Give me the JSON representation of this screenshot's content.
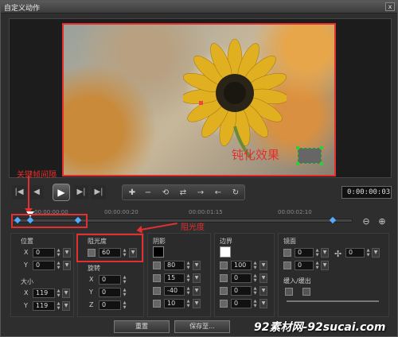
{
  "window": {
    "title": "自定义动作",
    "close_glyph": "x"
  },
  "preview": {
    "annotation_text": "钝化效果"
  },
  "annotations": {
    "keyframe_interval": "关键帧间隔",
    "opacity_pointer": "阻光度"
  },
  "transport": {
    "home_icon": "|◀",
    "prev_icon": "◀",
    "play_icon": "▶",
    "next_icon": "▶|",
    "end_icon": "▶|",
    "timecode": "0:00:00:03",
    "tools": [
      "✚",
      "−",
      "⟲",
      "⇄",
      "→",
      "←",
      "↻"
    ]
  },
  "timeline": {
    "labels": [
      "00:00:00:00",
      "00:00:00:20",
      "00:00:01:15",
      "00:00:02:10"
    ],
    "zoom_out": "⊖",
    "zoom_in": "⊕"
  },
  "position": {
    "label": "位置",
    "x_label": "X",
    "y_label": "Y",
    "x": "0",
    "y": "0"
  },
  "size": {
    "label": "大小",
    "x_label": "X",
    "y_label": "Y",
    "x": "119",
    "y": "119"
  },
  "opacity": {
    "label": "阻光度",
    "value": "60"
  },
  "rotation": {
    "label": "旋转",
    "x_label": "X",
    "y_label": "Y",
    "z_label": "Z",
    "x": "0",
    "y": "0",
    "z": "0"
  },
  "shadow": {
    "label": "阴影",
    "color": "#000000",
    "v1": "80",
    "v2": "15",
    "v3": "-40",
    "v4": "10"
  },
  "border": {
    "label": "边界",
    "color": "#ffffff",
    "v1": "100",
    "v2": "0",
    "v3": "0",
    "v4": "0"
  },
  "mirror": {
    "label": "镜面",
    "v1": "0",
    "v2": "0",
    "v3": "0"
  },
  "fade": {
    "label": "缓入/缓出"
  },
  "buttons": {
    "reset": "重置",
    "save_to": "保存至..."
  },
  "watermark": "92素材网-92sucai.com"
}
